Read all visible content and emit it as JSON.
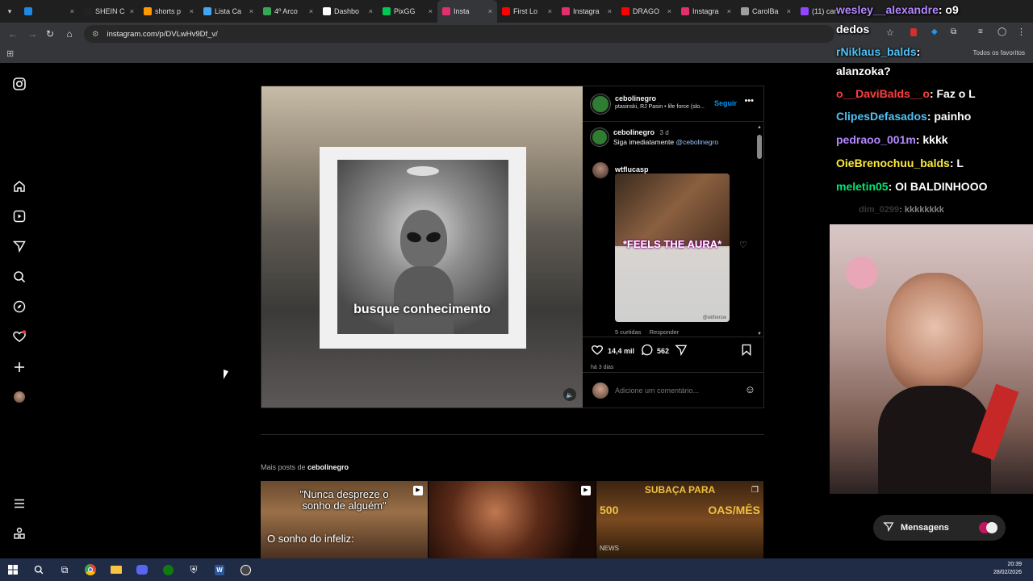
{
  "tabs": [
    {
      "label": "",
      "color": "#1e88e5"
    },
    {
      "label": "SHEIN C",
      "color": "#222222"
    },
    {
      "label": "shorts p",
      "color": "#ff9800"
    },
    {
      "label": "Lista Ca",
      "color": "#42a5f5"
    },
    {
      "label": "4º Arco",
      "color": "#34a853"
    },
    {
      "label": "Dashbo",
      "color": "#ffffff"
    },
    {
      "label": "PixGG",
      "color": "#00c853"
    },
    {
      "label": "Insta",
      "color": "#e1306c",
      "active": true
    },
    {
      "label": "First Lo",
      "color": "#ff0000"
    },
    {
      "label": "Instagra",
      "color": "#e1306c"
    },
    {
      "label": "DRAGO",
      "color": "#ff0000"
    },
    {
      "label": "Instagra",
      "color": "#e1306c"
    },
    {
      "label": "CarolBa",
      "color": "#9e9e9e"
    },
    {
      "label": "(11) car",
      "color": "#9146ff"
    }
  ],
  "address": {
    "url": "instagram.com/p/DVLwHv9Df_v/"
  },
  "bookmarks": {
    "all_label": "Todos os favoritos"
  },
  "post": {
    "overlay_text": "busque conhecimento",
    "author": "cebolinegro",
    "audio": "ptasinski, RJ Pasin • life force (slo...",
    "follow_label": "Seguir",
    "caption_author": "cebolinegro",
    "caption_time": "3 d",
    "caption_text": "Siga imediatamente",
    "caption_mention": "@cebolinegro",
    "comment_user": "wtflucasp",
    "gif_text": "*FEELS THE AURA*",
    "gif_watermark": "@withersw",
    "comment_likes": "5 curtidas",
    "reply_label": "Responder",
    "likes": "14,4 mil",
    "comments_count": "562",
    "time_ago": "há 3 dias",
    "add_comment_placeholder": "Adicione um comentário..."
  },
  "more_posts": {
    "prefix": "Mais posts de",
    "author": "cebolinegro",
    "thumb1_line1": "\"Nunca despreze o",
    "thumb1_line2": "sonho de alguém\"",
    "thumb1_line3": "O sonho do infeliz:",
    "thumb3_line1": "SUBAÇA PARA",
    "thumb3_line2": "500",
    "thumb3_line3": "OAS/MÊS",
    "thumb3_tag": "NEWS"
  },
  "chat": [
    {
      "user": "wesley__alexandre",
      "msg": ": o9",
      "color": "#b388ff"
    },
    {
      "user": "",
      "msg": "dedos",
      "color": "#ffffff"
    },
    {
      "user": "rNiklaus_balds",
      "msg": ":",
      "color": "#4fc3f7"
    },
    {
      "user": "",
      "msg": "alanzoka?",
      "color": "#ffffff"
    },
    {
      "user": "o__DaviBalds__o",
      "msg": ": Faz o L",
      "color": "#ff3d3d"
    },
    {
      "user": "ClipesDefasados",
      "msg": ": painho",
      "color": "#4fc3f7"
    },
    {
      "user": "pedraoo_001m",
      "msg": ": kkkk",
      "color": "#b388ff"
    },
    {
      "user": "OieBrenochuu_balds",
      "msg": ": L",
      "color": "#ffeb3b"
    },
    {
      "user": "meletin05",
      "msg": ": OI BALDINHOOO",
      "color": "#00e676"
    },
    {
      "user": "dim_0299",
      "msg": ": kkkkkkkk",
      "color": "#6c6c6c"
    }
  ],
  "messages_btn": {
    "label": "Mensagens"
  },
  "clock": {
    "time": "20:39",
    "date": "28/02/2026"
  }
}
